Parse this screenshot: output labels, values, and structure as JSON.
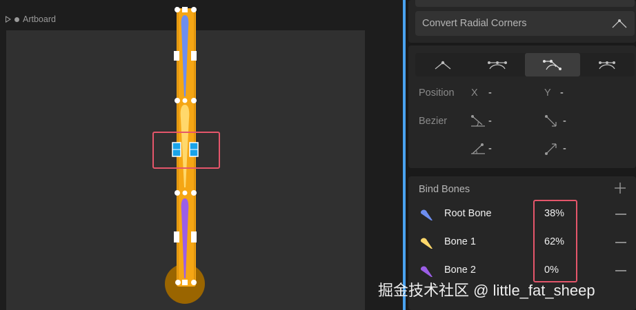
{
  "canvas": {
    "artboard_label": "Artboard",
    "mesh_colors": {
      "body": "#f5a614",
      "body_edge": "#c98207",
      "root_bone": "#6d8ef0",
      "bone_1": "#ffd86b",
      "bone_2": "#9b5ee6",
      "handle": "#ffffff",
      "selected_vertex": "#1aa3e8",
      "end_joint": "#9a6500"
    },
    "highlight_color": "#e5566b"
  },
  "inspector": {
    "convert_radial_corners_label": "Convert Radial Corners",
    "vertex_types": [
      {
        "name": "straight",
        "active": false
      },
      {
        "name": "mirrored",
        "active": false
      },
      {
        "name": "detached",
        "active": true
      },
      {
        "name": "asymmetric",
        "active": false
      }
    ],
    "position": {
      "label": "Position",
      "x_axis": "X",
      "x_value": "-",
      "y_axis": "Y",
      "y_value": "-"
    },
    "bezier": {
      "label": "Bezier",
      "in_x": "-",
      "out_x": "-",
      "in_y": "-",
      "out_y": "-"
    },
    "bind_bones": {
      "title": "Bind Bones",
      "bones": [
        {
          "name": "Root Bone",
          "weight": "38%",
          "color": "#6d8ef0"
        },
        {
          "name": "Bone 1",
          "weight": "62%",
          "color": "#ffd86b"
        },
        {
          "name": "Bone 2",
          "weight": "0%",
          "color": "#9b5ee6"
        }
      ]
    }
  },
  "watermark": "掘金技术社区 @ little_fat_sheep"
}
